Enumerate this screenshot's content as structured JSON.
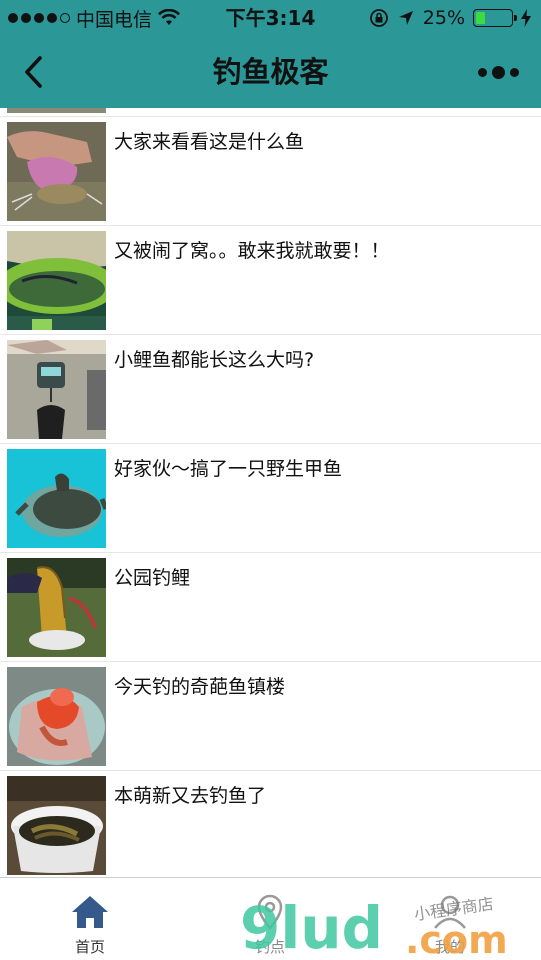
{
  "status_bar": {
    "carrier": "中国电信",
    "time": "下午3:14",
    "battery": "25%",
    "battery_level": 0.25
  },
  "nav": {
    "title": "钓鱼极客"
  },
  "list": {
    "items": [
      {
        "title": "大家来看看这是什么鱼"
      },
      {
        "title": "又被闹了窝。。敢来我就敢要！！"
      },
      {
        "title": "小鲤鱼都能长这么大吗?"
      },
      {
        "title": "好家伙～搞了一只野生甲鱼"
      },
      {
        "title": "公园钓鲤"
      },
      {
        "title": "今天钓的奇葩鱼镇楼"
      },
      {
        "title": "本萌新又去钓鱼了"
      }
    ]
  },
  "tabs": [
    {
      "label": "首页",
      "icon": "home-icon",
      "active": true
    },
    {
      "label": "钓点",
      "icon": "location-icon",
      "active": false
    },
    {
      "label": "我的",
      "icon": "user-icon",
      "active": false
    }
  ],
  "watermark": {
    "text": "9lud.com",
    "handwriting": "小程序商店"
  }
}
